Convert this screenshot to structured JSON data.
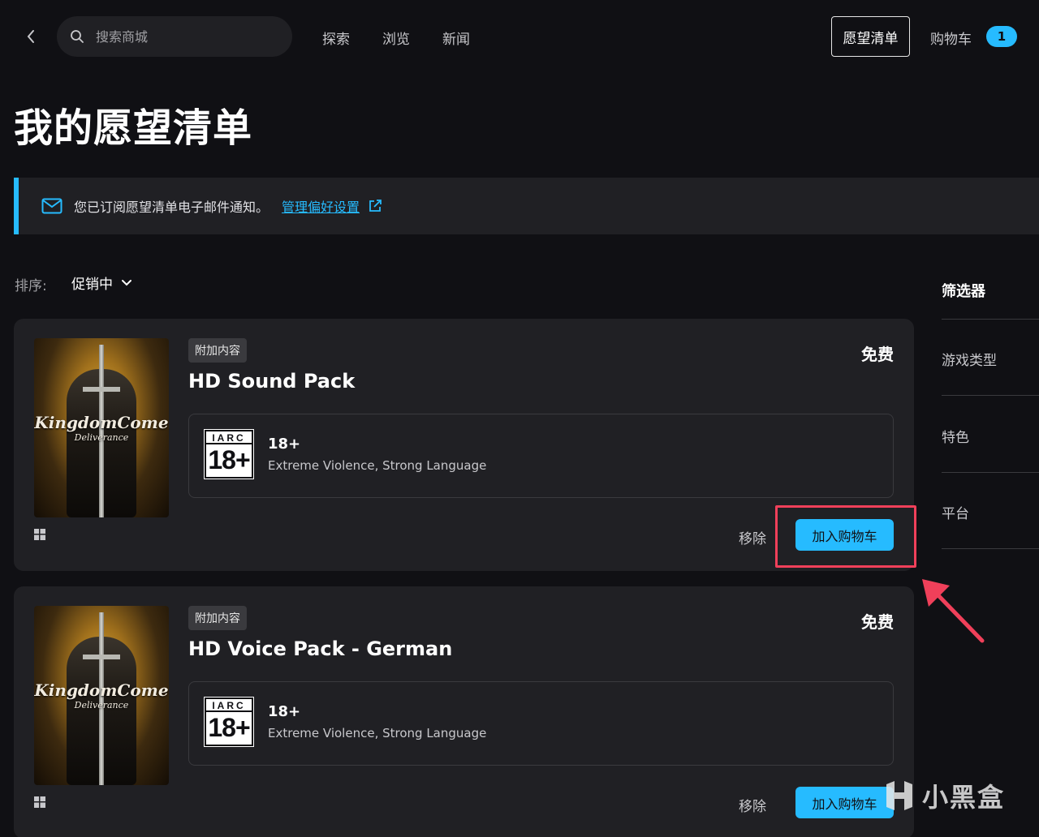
{
  "nav": {
    "search_placeholder": "搜索商城",
    "links": [
      "探索",
      "浏览",
      "新闻"
    ],
    "wishlist_label": "愿望清单",
    "cart_label": "购物车",
    "cart_count": "1"
  },
  "page": {
    "title": "我的愿望清单"
  },
  "notice": {
    "text": "您已订阅愿望清单电子邮件通知。",
    "link": "管理偏好设置"
  },
  "sort": {
    "label": "排序:",
    "value": "促销中"
  },
  "filters": {
    "title": "筛选器",
    "items": [
      "游戏类型",
      "特色",
      "平台"
    ]
  },
  "items": [
    {
      "badge": "附加内容",
      "title": "HD Sound Pack",
      "price": "免费",
      "cover_logo": "KingdomCome",
      "cover_sub": "Deliverance",
      "rating_org": "IARC",
      "rating_age_badge": "18+",
      "rating_age": "18+",
      "rating_desc": "Extreme Violence, Strong Language",
      "remove_label": "移除",
      "add_to_cart_label": "加入购物车"
    },
    {
      "badge": "附加内容",
      "title": "HD Voice Pack - German",
      "price": "免费",
      "cover_logo": "KingdomCome",
      "cover_sub": "Deliverance",
      "rating_org": "IARC",
      "rating_age_badge": "18+",
      "rating_age": "18+",
      "rating_desc": "Extreme Violence, Strong Language",
      "remove_label": "移除",
      "add_to_cart_label": "加入购物车"
    }
  ],
  "watermark": {
    "text": "小黑盒"
  },
  "colors": {
    "background": "#101014",
    "surface": "#202024",
    "accent": "#26bbff",
    "annotation": "#f0405a"
  }
}
